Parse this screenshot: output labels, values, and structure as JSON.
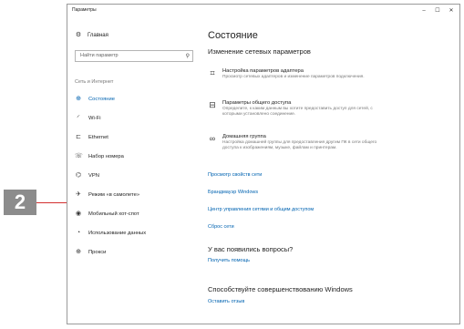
{
  "callout": {
    "number": "2"
  },
  "window": {
    "title": "Параметры",
    "controls": {
      "minimize": "–",
      "maximize": "☐",
      "close": "✕"
    }
  },
  "sidebar": {
    "home": "Главная",
    "search_placeholder": "Найти параметр",
    "section": "Сеть и Интернет",
    "items": [
      {
        "label": "Состояние",
        "icon": "globe-icon"
      },
      {
        "label": "Wi-Fi",
        "icon": "wifi-icon"
      },
      {
        "label": "Ethernet",
        "icon": "ethernet-icon"
      },
      {
        "label": "Набор номера",
        "icon": "dialup-icon"
      },
      {
        "label": "VPN",
        "icon": "vpn-icon"
      },
      {
        "label": "Режим «в самолете»",
        "icon": "airplane-icon"
      },
      {
        "label": "Мобильный хот-спот",
        "icon": "hotspot-icon"
      },
      {
        "label": "Использование данных",
        "icon": "data-usage-icon"
      },
      {
        "label": "Прокси",
        "icon": "proxy-icon"
      }
    ]
  },
  "main": {
    "title": "Состояние",
    "subtitle": "Изменение сетевых параметров",
    "options": [
      {
        "title": "Настройка параметров адаптера",
        "desc": "Просмотр сетевых адаптеров и изменение параметров подключения."
      },
      {
        "title": "Параметры общего доступа",
        "desc": "Определите, к каким данным вы хотите предоставить доступ для сетей, с которыми установлено соединение."
      },
      {
        "title": "Домашняя группа",
        "desc": "Настройка домашней группы для предоставления другим ПК в сети общего доступа к изображениям, музыке, файлам и принтерам."
      }
    ],
    "links": [
      "Просмотр свойств сети",
      "Брандмауэр Windows",
      "Центр управления сетями и общим доступом",
      "Сброс сети"
    ],
    "question_heading": "У вас появились вопросы?",
    "help_link": "Получить помощь",
    "improve_heading": "Способствуйте совершенствованию Windows",
    "feedback_link": "Оставить отзыв"
  }
}
